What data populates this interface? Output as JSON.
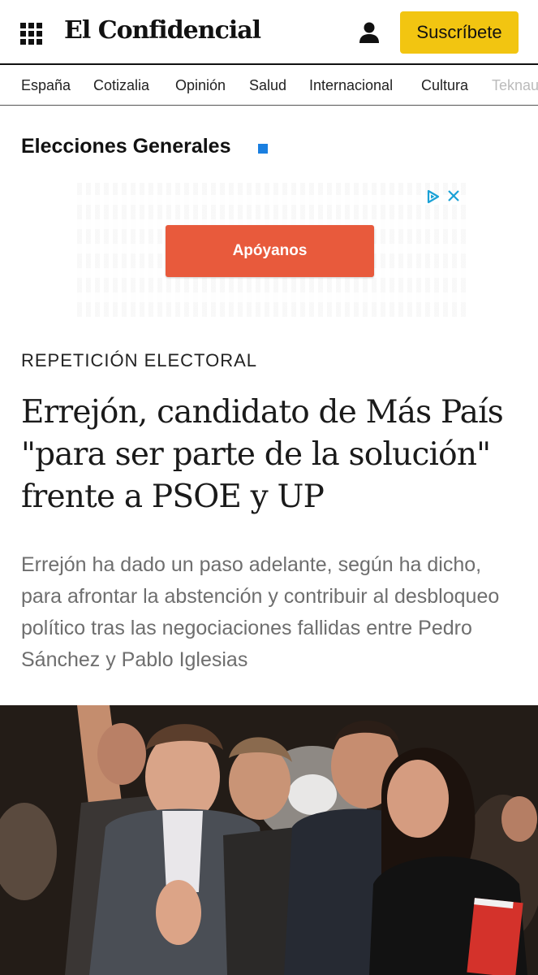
{
  "header": {
    "logo": "El Confidencial",
    "subscribe_label": "Suscríbete",
    "menu_icon": "grid-menu-icon",
    "user_icon": "user-icon"
  },
  "nav": {
    "items": [
      "España",
      "Cotizalia",
      "Opinión",
      "Salud",
      "Internacional",
      "Cultura",
      "Teknautas"
    ]
  },
  "section": {
    "title": "Elecciones Generales"
  },
  "ad": {
    "button_label": "Apóyanos"
  },
  "article": {
    "kicker": "REPETICIÓN ELECTORAL",
    "headline": "Errejón, candidato de Más País \"para ser parte de la solución\" frente a PSOE y UP",
    "summary": "Errejón ha dado un paso adelante, según ha dicho, para afrontar la abstención y contribuir al desbloqueo político tras las negociaciones fallidas entre Pedro Sánchez y Pablo Iglesias"
  },
  "colors": {
    "subscribe_bg": "#f2c511",
    "section_square": "#1a7fe0",
    "ad_button": "#e85a3c",
    "summary_text": "#6e6e6e"
  }
}
